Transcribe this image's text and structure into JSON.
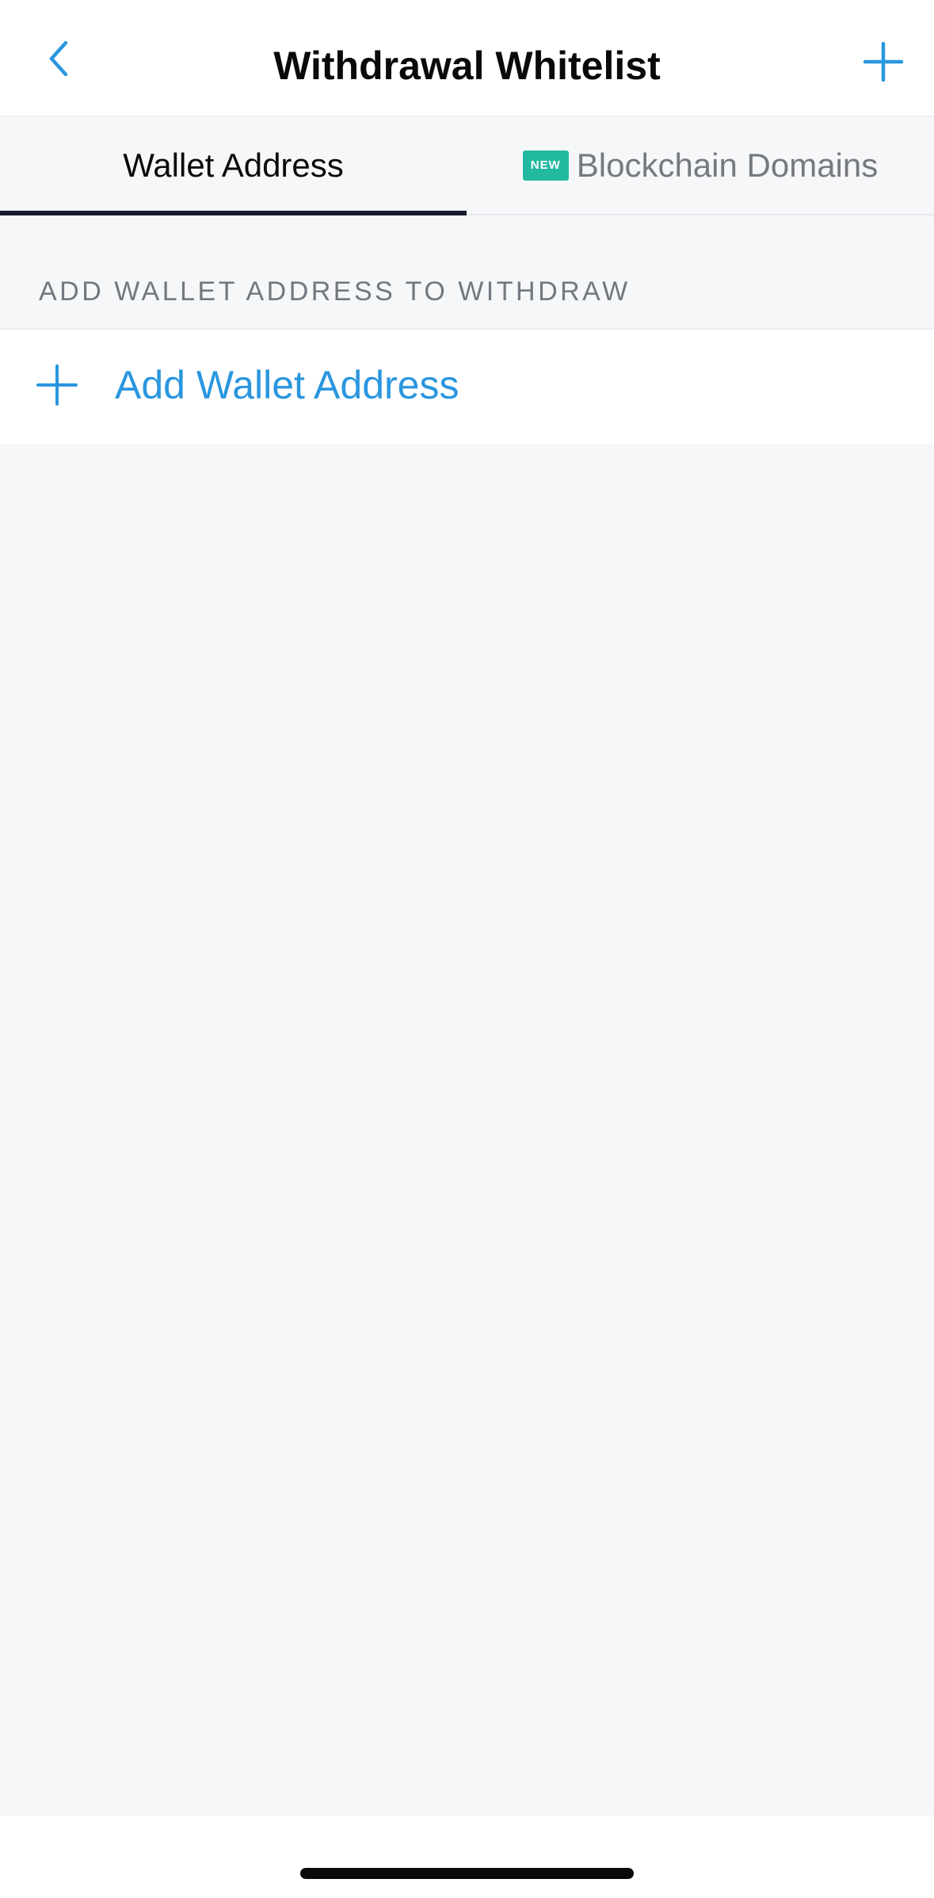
{
  "header": {
    "title": "Withdrawal Whitelist",
    "back_icon": "chevron-left-icon",
    "add_icon": "plus-icon"
  },
  "tabs": [
    {
      "label": "Wallet Address",
      "active": true
    },
    {
      "label": "Blockchain Domains",
      "active": false,
      "badge": "NEW"
    }
  ],
  "section": {
    "header": "ADD WALLET ADDRESS TO WITHDRAW",
    "add_label": "Add Wallet Address",
    "add_icon": "plus-icon"
  },
  "colors": {
    "accent": "#2a96df",
    "badge": "#22b9a0",
    "tab_indicator": "#131a2a",
    "background": "#f5f7f9"
  }
}
